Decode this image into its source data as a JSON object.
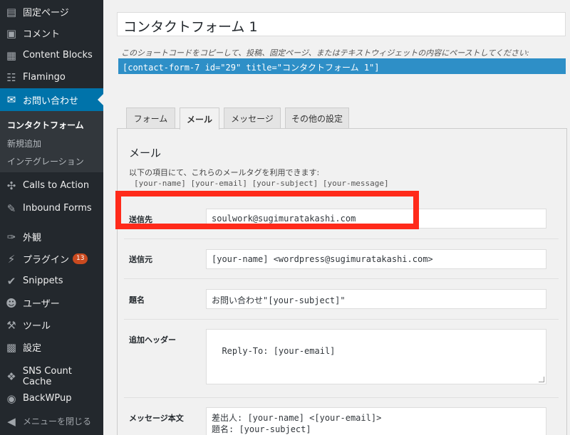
{
  "sidebar": {
    "items": [
      {
        "label": "固定ページ",
        "icon": "page-icon"
      },
      {
        "label": "コメント",
        "icon": "comment-icon"
      },
      {
        "label": "Content Blocks",
        "icon": "blocks-icon"
      },
      {
        "label": "Flamingo",
        "icon": "flamingo-icon"
      },
      {
        "label": "お問い合わせ",
        "icon": "mail-icon"
      },
      {
        "label": "Calls to Action",
        "icon": "crosshair-icon"
      },
      {
        "label": "Inbound Forms",
        "icon": "form-icon"
      },
      {
        "label": "外観",
        "icon": "brush-icon"
      },
      {
        "label": "プラグイン",
        "icon": "plugin-icon",
        "badge": "13"
      },
      {
        "label": "Snippets",
        "icon": "snippets-icon"
      },
      {
        "label": "ユーザー",
        "icon": "user-icon"
      },
      {
        "label": "ツール",
        "icon": "wrench-icon"
      },
      {
        "label": "設定",
        "icon": "settings-icon"
      },
      {
        "label": "SNS Count Cache",
        "icon": "share-icon"
      },
      {
        "label": "BackWPup",
        "icon": "backwpup-icon"
      },
      {
        "label": "メニューを閉じる",
        "icon": "collapse-icon"
      }
    ],
    "submenu": [
      "コンタクトフォーム",
      "新規追加",
      "インテグレーション"
    ]
  },
  "form_title": "コンタクトフォーム 1",
  "hint": "このショートコードをコピーして、投稿、固定ページ、またはテキストウィジェットの内容にペーストしてください:",
  "shortcode": "[contact-form-7 id=\"29\" title=\"コンタクトフォーム 1\"]",
  "tabs": [
    "フォーム",
    "メール",
    "メッセージ",
    "その他の設定"
  ],
  "mail": {
    "title": "メール",
    "description": "以下の項目にて、これらのメールタグを利用できます:",
    "tags": "[your-name] [your-email] [your-subject] [your-message]",
    "fields": {
      "to": {
        "label": "送信先",
        "value": "soulwork@sugimuratakashi.com"
      },
      "from": {
        "label": "送信元",
        "value": "[your-name] <wordpress@sugimuratakashi.com>"
      },
      "subject": {
        "label": "題名",
        "value": "お問い合わせ\"[your-subject]\""
      },
      "headers": {
        "label": "追加ヘッダー",
        "value": "Reply-To: [your-email]"
      },
      "body": {
        "label": "メッセージ本文",
        "value": "差出人: [your-name] <[your-email]>\n題名: [your-subject]"
      }
    }
  },
  "colors": {
    "admin_bg": "#23282d",
    "accent": "#0073aa",
    "highlight": "#ff2a1a",
    "shortcode_bg": "#2e8fc7"
  }
}
